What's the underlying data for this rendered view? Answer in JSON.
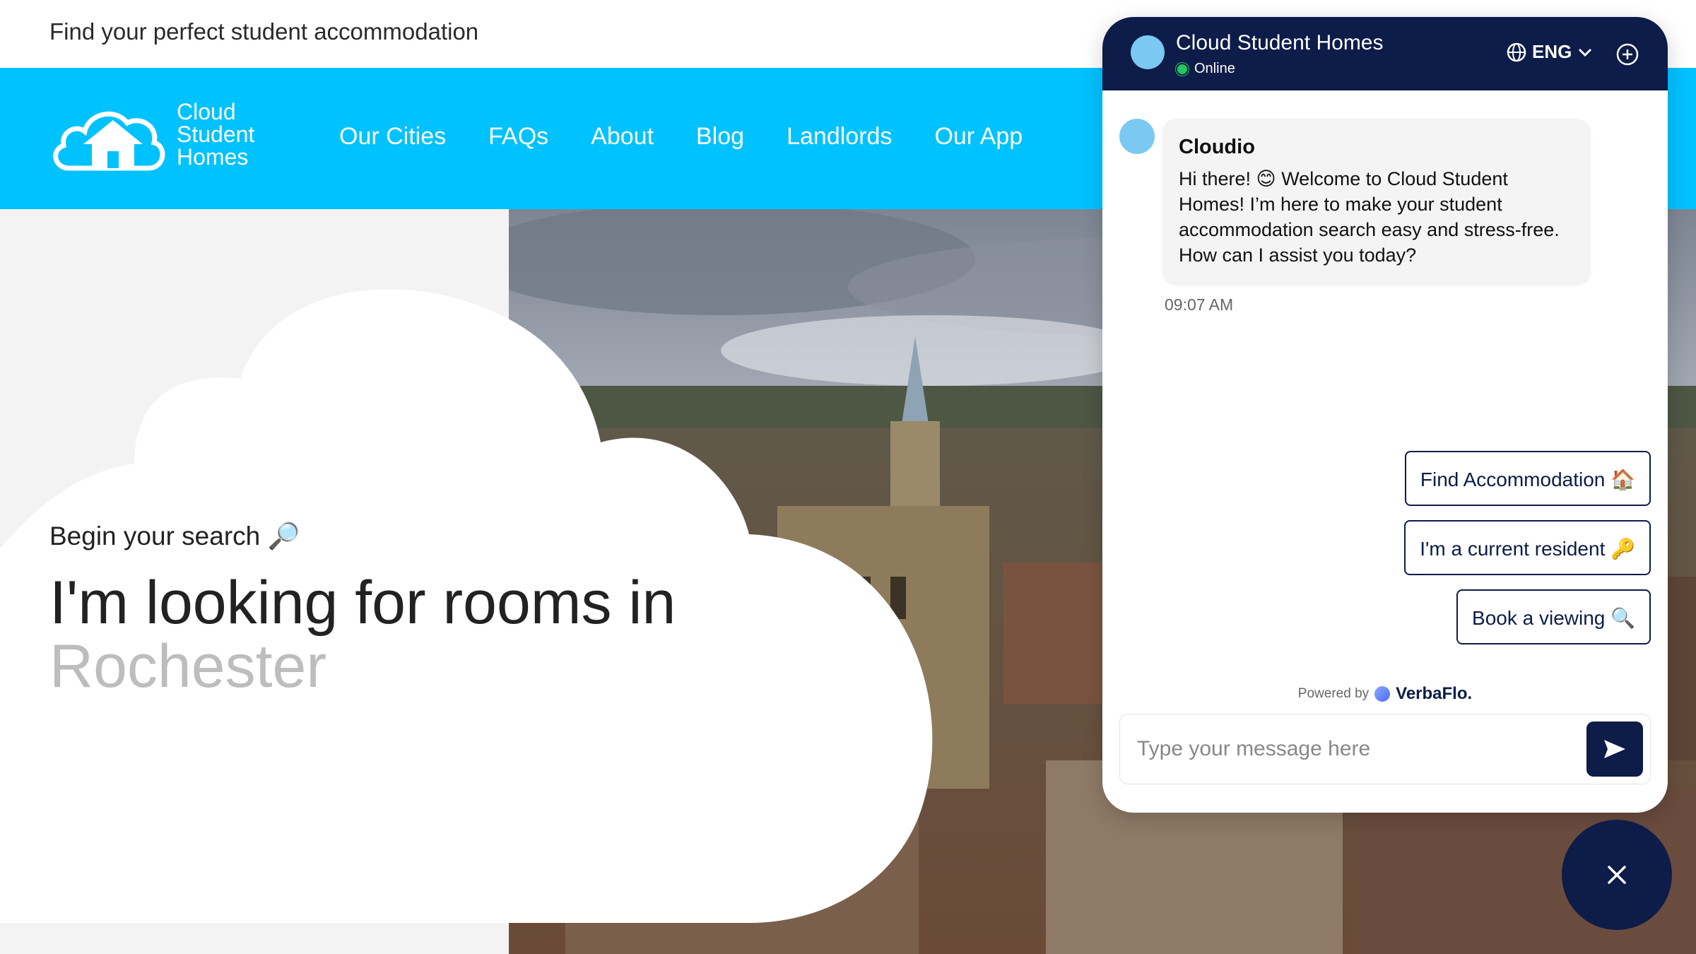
{
  "site": {
    "tagline": "Find your perfect student accommodation",
    "logo_lines": [
      "Cloud",
      "Student",
      "Homes"
    ],
    "nav": [
      "Our Cities",
      "FAQs",
      "About",
      "Blog",
      "Landlords",
      "Our App"
    ],
    "brand_color": "#00c2ff"
  },
  "hero": {
    "begin": "Begin your search 🔎",
    "headline": "I'm looking for rooms in",
    "city": "Rochester"
  },
  "chat": {
    "title": "Cloud Student Homes",
    "status": "Online",
    "language": "ENG",
    "bot_name": "Cloudio",
    "message": "Hi there! 😊  Welcome to Cloud Student Homes! I’m here to make your student accommodation search easy and stress-free. How can I assist you today?",
    "time": "09:07 AM",
    "quick_replies": [
      "Find Accommodation 🏠",
      "I'm a current resident 🔑",
      "Book a viewing 🔍"
    ],
    "powered_by": "Powered by",
    "powered_brand": "VerbaFlo.",
    "input_placeholder": "Type your message here",
    "header_color": "#0d1c48"
  }
}
